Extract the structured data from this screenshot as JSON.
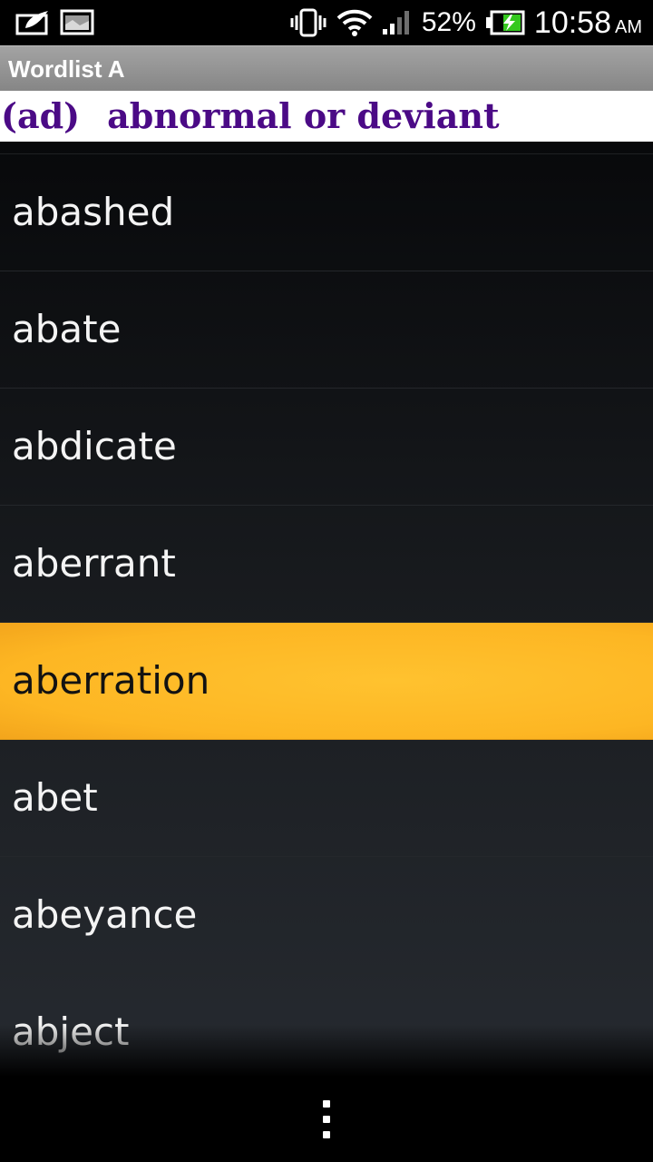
{
  "status_bar": {
    "battery_percent": "52%",
    "time": "10:58",
    "ampm": "AM",
    "icons": [
      "notification-icon",
      "image-icon",
      "vibrate-icon",
      "wifi-icon",
      "signal-icon",
      "battery-charging-icon"
    ]
  },
  "app": {
    "title": "Wordlist A"
  },
  "definition": {
    "part_of_speech": "(ad)",
    "text": "abnormal or deviant"
  },
  "words": [
    {
      "label": "abashed"
    },
    {
      "label": "abate"
    },
    {
      "label": "abdicate"
    },
    {
      "label": "aberrant"
    },
    {
      "label": "aberration"
    },
    {
      "label": "abet"
    },
    {
      "label": "abeyance"
    },
    {
      "label": "abject"
    }
  ],
  "selected_word": "aberration",
  "colors": {
    "selected_row": "#fdb623",
    "definition_text": "#4b0a86",
    "title_bar": "#8e8e8e"
  }
}
